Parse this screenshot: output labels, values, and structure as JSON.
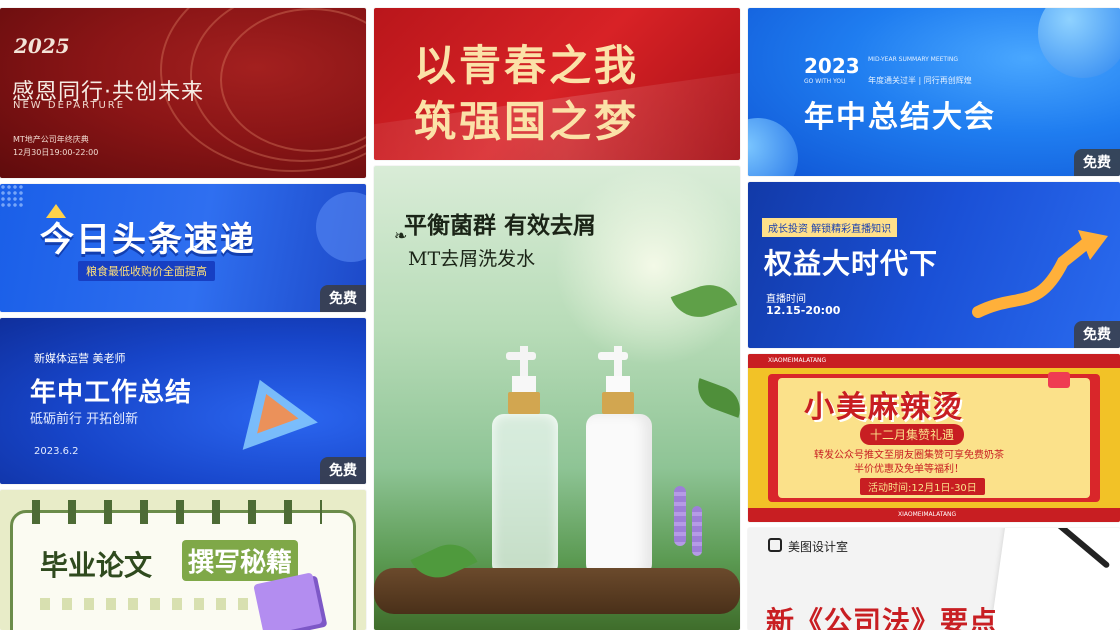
{
  "free_badge": "免费",
  "cards": [
    {
      "id": "thank-you-banner",
      "logo_text": "2025",
      "title": "感恩同行·共创未来",
      "subtitle": "NEW DEPARTURE",
      "line1": "MT地产公司年终庆典",
      "line2": "12月30日19:00-22:00"
    },
    {
      "id": "headline-news",
      "title": "今日头条速递",
      "subtitle": "粮食最低收购价全面提高",
      "free": true
    },
    {
      "id": "midyear-work-summary",
      "tag": "新媒体运营 美老师",
      "title": "年中工作总结",
      "subtitle": "砥砺前行 开拓创新",
      "date": "2023.6.2",
      "free": true
    },
    {
      "id": "thesis-guide",
      "title_a": "毕业论文",
      "title_b": "撰写秘籍"
    },
    {
      "id": "youth-dream",
      "line1": "以青春之我",
      "line2": "筑强国之梦"
    },
    {
      "id": "shampoo-ad",
      "title": "平衡菌群 有效去屑",
      "subtitle": "MT去屑洗发水"
    },
    {
      "id": "midyear-summary-meeting",
      "year": "2023",
      "small_en": "MID-YEAR SUMMARY MEETING",
      "go_with_you": "GO WITH YOU",
      "slogan": "年度通关过半 | 同行再创辉煌",
      "title": "年中总结大会",
      "free": true
    },
    {
      "id": "equity-era-live",
      "tag": "成长投资  解锁精彩直播知识",
      "title": "权益大时代下",
      "time_label": "直播时间",
      "time_value": "12.15-20:00",
      "free": true
    },
    {
      "id": "malatang-promo",
      "brand_strip": "XIAOMEIMALATANG",
      "title": "小美麻辣烫",
      "ribbon": "十二月集赞礼遇",
      "body1": "转发公众号推文至朋友圈集赞可享免费奶茶",
      "body2": "半价优惠及免单等福利！",
      "event": "活动时间:12月1日-30日"
    },
    {
      "id": "company-law",
      "brand": "美图设计室",
      "title": "新《公司法》要点"
    }
  ],
  "colors": {
    "badge_bg": "#3c3c3c",
    "red": "#c81e22",
    "blue": "#1f6df0",
    "yellow": "#f2c227",
    "gold": "#f4d38a"
  }
}
